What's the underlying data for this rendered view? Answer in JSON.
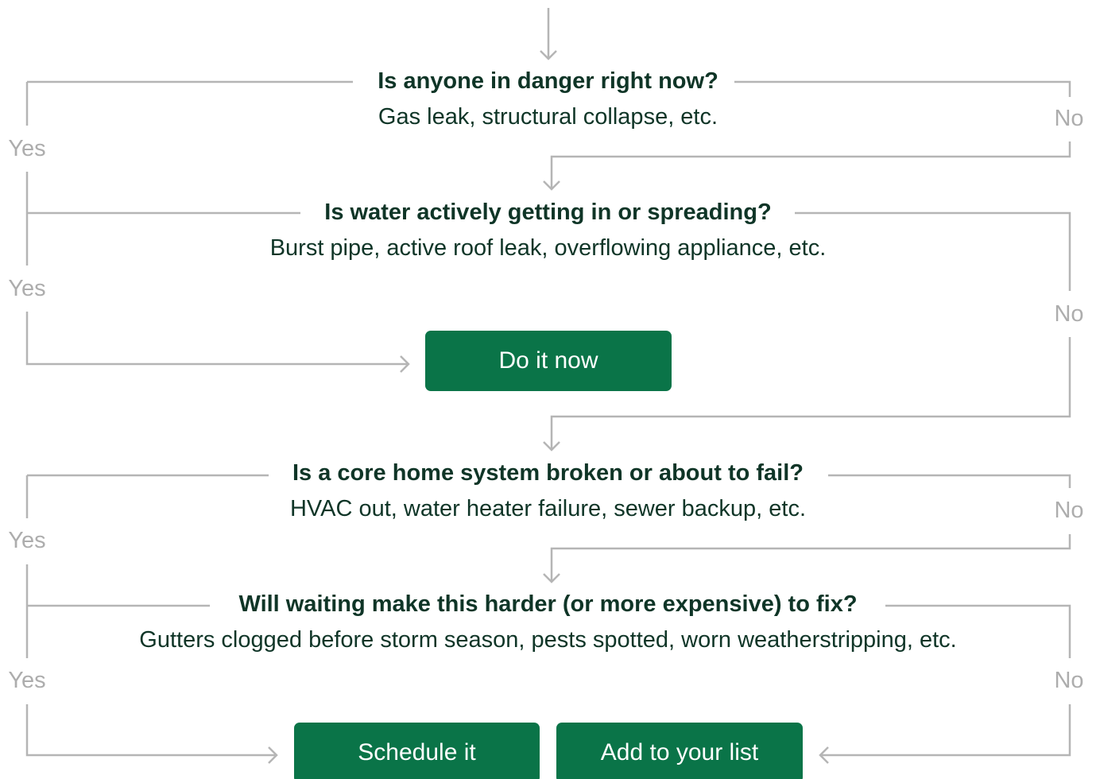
{
  "questions": [
    {
      "title": "Is anyone in danger right now?",
      "example": "Gas leak, structural collapse, etc."
    },
    {
      "title": "Is water actively getting in or spreading?",
      "example": "Burst pipe, active roof leak, overflowing appliance, etc."
    },
    {
      "title": "Is a core home system broken or about to fail?",
      "example": "HVAC out, water heater failure, sewer backup, etc."
    },
    {
      "title": "Will waiting make this harder (or more expensive) to fix?",
      "example": "Gutters clogged before storm season, pests spotted, worn weatherstripping, etc."
    }
  ],
  "labels": {
    "yes": "Yes",
    "no": "No"
  },
  "outcomes": {
    "do_now": "Do it now",
    "schedule": "Schedule it",
    "add_list": "Add to your list"
  },
  "colors": {
    "primary_green": "#0a7448",
    "text_dark": "#0f3527",
    "connector_gray": "#adadad"
  }
}
